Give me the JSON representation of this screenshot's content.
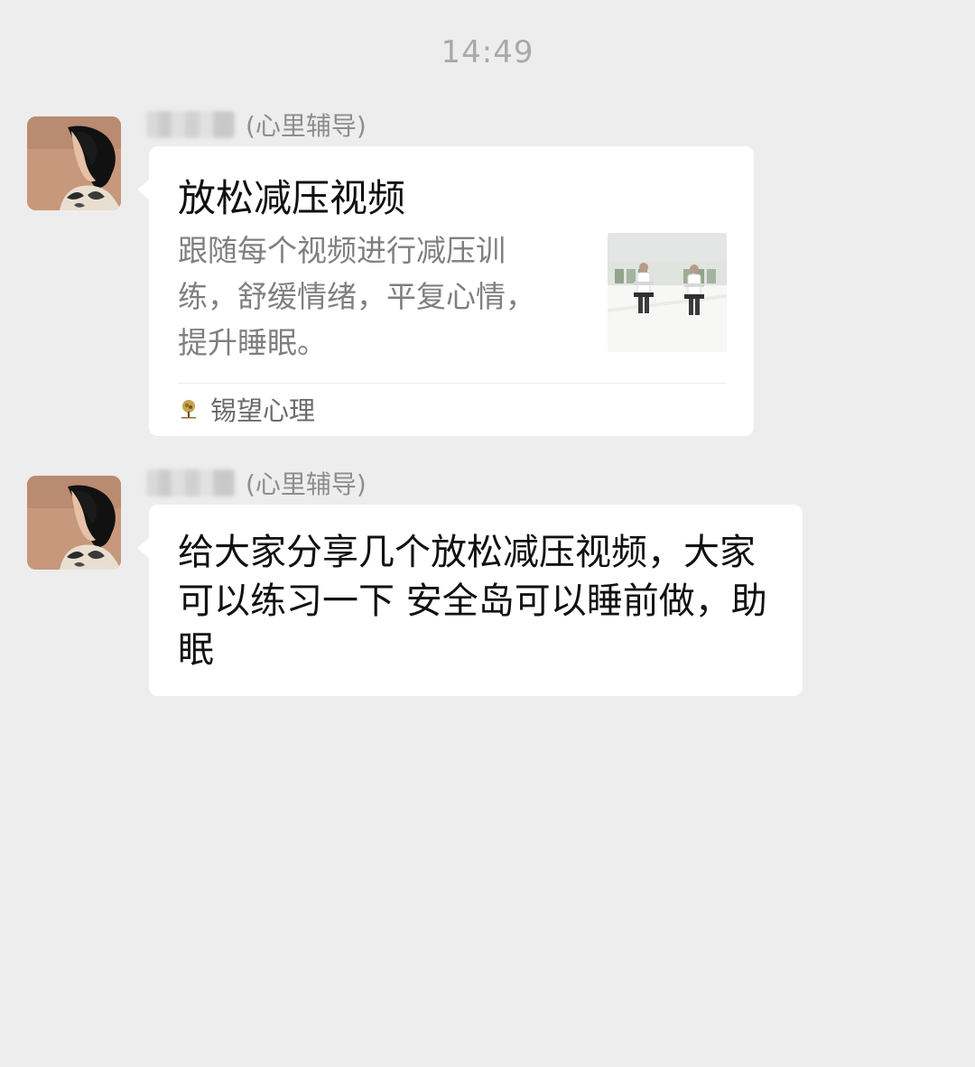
{
  "timestamp": "14:49",
  "messages": [
    {
      "sender_tag": "(心里辅导)",
      "type": "link_card",
      "card": {
        "title": "放松减压视频",
        "description": "跟随每个视频进行减压训练，舒缓情绪，平复心情，提升睡眠。",
        "source": "锡望心理"
      }
    },
    {
      "sender_tag": "(心里辅导)",
      "type": "text",
      "text": "给大家分享几个放松减压视频，大家可以练习一下  安全岛可以睡前做，助眠"
    }
  ]
}
